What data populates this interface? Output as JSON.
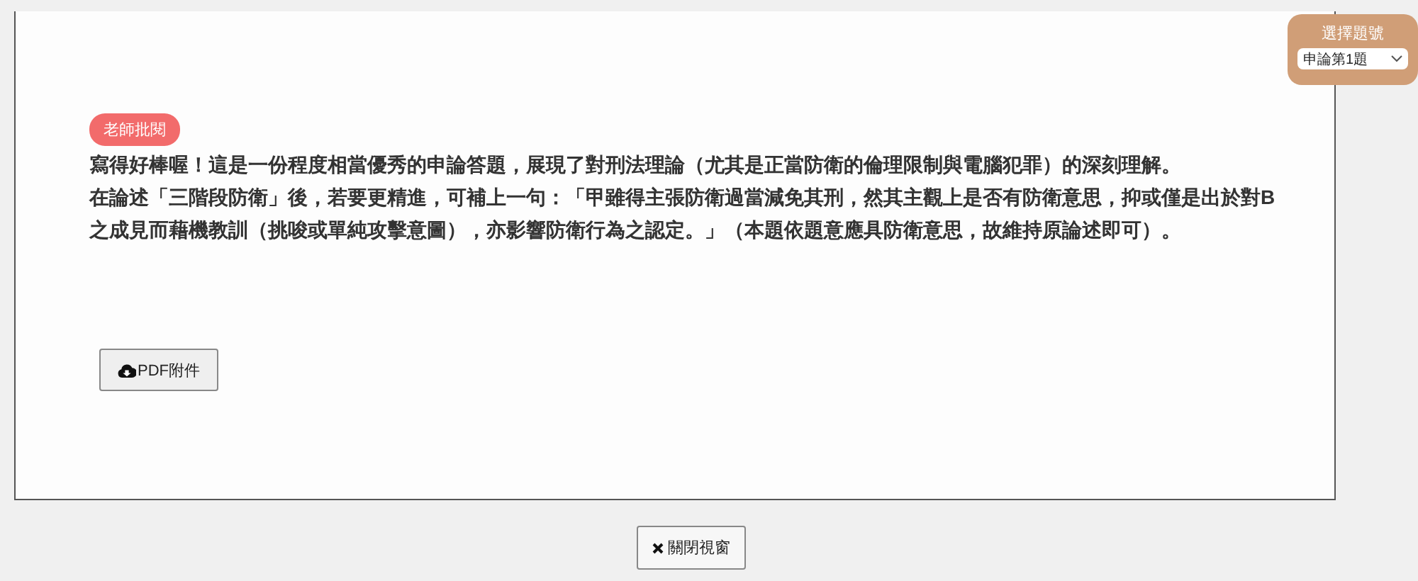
{
  "question_picker": {
    "title": "選擇題號",
    "value": "申論第1題"
  },
  "review": {
    "badge": "老師批閱",
    "paragraphs": [
      "寫得好棒喔！這是一份程度相當優秀的申論答題，展現了對刑法理論（尤其是正當防衛的倫理限制與電腦犯罪）的深刻理解。",
      "在論述「三階段防衛」後，若要更精進，可補上一句：「甲雖得主張防衛過當減免其刑，然其主觀上是否有防衛意思，抑或僅是出於對B之成見而藉機教訓（挑唆或單純攻擊意圖），亦影響防衛行為之認定。」（本題依題意應具防衛意思，故維持原論述即可）。"
    ]
  },
  "attachment_button": "PDF附件",
  "close_button": "關閉視窗"
}
